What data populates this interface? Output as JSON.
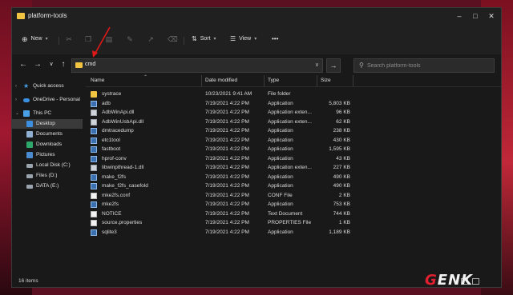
{
  "window": {
    "title": "platform-tools"
  },
  "toolbar": {
    "new_label": "New",
    "sort_label": "Sort",
    "view_label": "View",
    "more_label": "•••"
  },
  "address": {
    "value": "cmd"
  },
  "search": {
    "placeholder": "Search platform-tools"
  },
  "sidebar": {
    "items": [
      {
        "label": "Quick access"
      },
      {
        "label": "OneDrive - Personal"
      },
      {
        "label": "This PC"
      },
      {
        "label": "Desktop"
      },
      {
        "label": "Documents"
      },
      {
        "label": "Downloads"
      },
      {
        "label": "Pictures"
      },
      {
        "label": "Local Disk (C:)"
      },
      {
        "label": "Files (D:)"
      },
      {
        "label": "DATA (E:)"
      }
    ]
  },
  "columns": {
    "name": "Name",
    "date": "Date modified",
    "type": "Type",
    "size": "Size"
  },
  "files": [
    {
      "name": "systrace",
      "date": "10/23/2021 9:41 AM",
      "type": "File folder",
      "size": "",
      "kind": "folder"
    },
    {
      "name": "adb",
      "date": "7/19/2021 4:22 PM",
      "type": "Application",
      "size": "5,803 KB",
      "kind": "exe"
    },
    {
      "name": "AdbWinApi.dll",
      "date": "7/19/2021 4:22 PM",
      "type": "Application exten...",
      "size": "96 KB",
      "kind": "dll"
    },
    {
      "name": "AdbWinUsbApi.dll",
      "date": "7/19/2021 4:22 PM",
      "type": "Application exten...",
      "size": "62 KB",
      "kind": "dll"
    },
    {
      "name": "dmtracedump",
      "date": "7/19/2021 4:22 PM",
      "type": "Application",
      "size": "238 KB",
      "kind": "exe"
    },
    {
      "name": "etc1tool",
      "date": "7/19/2021 4:22 PM",
      "type": "Application",
      "size": "430 KB",
      "kind": "exe"
    },
    {
      "name": "fastboot",
      "date": "7/19/2021 4:22 PM",
      "type": "Application",
      "size": "1,595 KB",
      "kind": "exe"
    },
    {
      "name": "hprof-conv",
      "date": "7/19/2021 4:22 PM",
      "type": "Application",
      "size": "43 KB",
      "kind": "exe"
    },
    {
      "name": "libwinpthread-1.dll",
      "date": "7/19/2021 4:22 PM",
      "type": "Application exten...",
      "size": "227 KB",
      "kind": "dll"
    },
    {
      "name": "make_f2fs",
      "date": "7/19/2021 4:22 PM",
      "type": "Application",
      "size": "490 KB",
      "kind": "exe"
    },
    {
      "name": "make_f2fs_casefold",
      "date": "7/19/2021 4:22 PM",
      "type": "Application",
      "size": "490 KB",
      "kind": "exe"
    },
    {
      "name": "mke2fs.conf",
      "date": "7/19/2021 4:22 PM",
      "type": "CONF File",
      "size": "2 KB",
      "kind": "doc"
    },
    {
      "name": "mke2fs",
      "date": "7/19/2021 4:22 PM",
      "type": "Application",
      "size": "753 KB",
      "kind": "exe"
    },
    {
      "name": "NOTICE",
      "date": "7/19/2021 4:22 PM",
      "type": "Text Document",
      "size": "744 KB",
      "kind": "doc"
    },
    {
      "name": "source.properties",
      "date": "7/19/2021 4:22 PM",
      "type": "PROPERTIES File",
      "size": "1 KB",
      "kind": "doc"
    },
    {
      "name": "sqlite3",
      "date": "7/19/2021 4:22 PM",
      "type": "Application",
      "size": "1,189 KB",
      "kind": "exe"
    }
  ],
  "status": {
    "items_count": "16 items"
  },
  "watermark": {
    "text": "GENK"
  },
  "colors": {
    "accent": "#e02030",
    "folder": "#f1c542",
    "window_bg": "#191919"
  }
}
